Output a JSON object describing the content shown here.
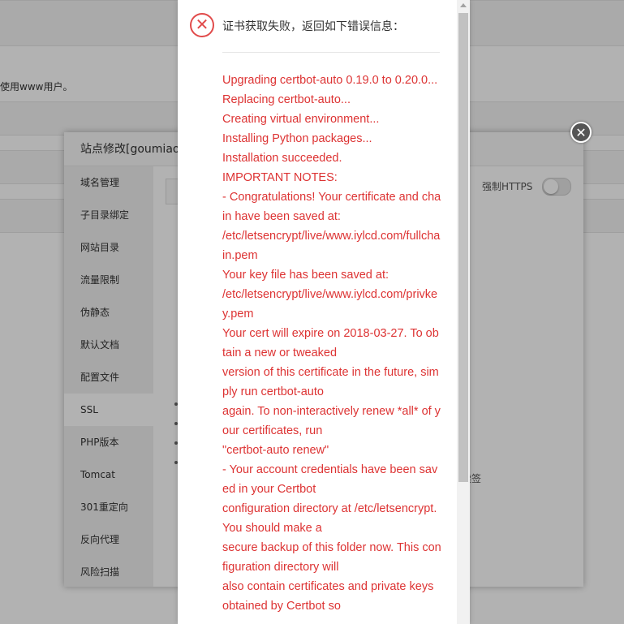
{
  "background": {
    "notice_text": "使用www用户。"
  },
  "site_dialog": {
    "title": "站点修改[goumiao",
    "close_icon": "close-icon",
    "nav": [
      {
        "label": "域名管理",
        "active": false
      },
      {
        "label": "子目录绑定",
        "active": false
      },
      {
        "label": "网站目录",
        "active": false
      },
      {
        "label": "流量限制",
        "active": false
      },
      {
        "label": "伪静态",
        "active": false
      },
      {
        "label": "默认文档",
        "active": false
      },
      {
        "label": "配置文件",
        "active": false
      },
      {
        "label": "SSL",
        "active": true
      },
      {
        "label": "PHP版本",
        "active": false
      },
      {
        "label": "Tomcat",
        "active": false
      },
      {
        "label": "301重定向",
        "active": false
      },
      {
        "label": "反向代理",
        "active": false
      },
      {
        "label": "风险扫描",
        "active": false
      }
    ],
    "force_https_label": "强制HTTPS",
    "force_https_enabled": false,
    "renew_text": "续签"
  },
  "error_dialog": {
    "icon": "error-x-icon",
    "accent_color": "#e14b4b",
    "heading": "证书获取失败，返回如下错误信息：",
    "lines": [
      "Upgrading certbot-auto 0.19.0 to 0.20.0...",
      "Replacing certbot-auto...",
      "Creating virtual environment...",
      "Installing Python packages...",
      "Installation succeeded.",
      "IMPORTANT NOTES:",
      "- Congratulations! Your certificate and chain have been saved at:",
      "/etc/letsencrypt/live/www.iylcd.com/fullchain.pem",
      "Your key file has been saved at:",
      "/etc/letsencrypt/live/www.iylcd.com/privkey.pem",
      "Your cert will expire on 2018-03-27. To obtain a new or tweaked",
      "version of this certificate in the future, simply run certbot-auto",
      "again. To non-interactively renew *all* of your certificates, run",
      "\"certbot-auto renew\"",
      "- Your account credentials have been saved in your Certbot",
      "configuration directory at /etc/letsencrypt. You should make a",
      "secure backup of this folder now. This configuration directory will",
      "also contain certificates and private keys obtained by Certbot so"
    ]
  }
}
